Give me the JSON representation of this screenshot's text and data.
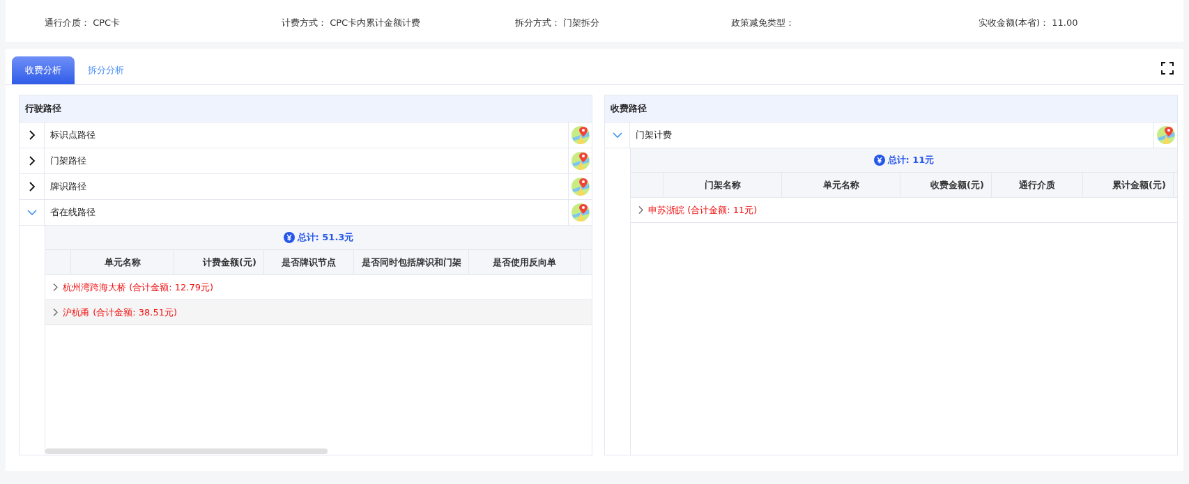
{
  "info": [
    {
      "label": "通行介质：",
      "value": "CPC卡"
    },
    {
      "label": "计费方式：",
      "value": "CPC卡内累计金额计费"
    },
    {
      "label": "拆分方式：",
      "value": "门架拆分"
    },
    {
      "label": "政策减免类型："
    },
    {
      "label": "实收金额(本省)：",
      "value": "11.00"
    }
  ],
  "tabs": [
    {
      "label": "收费分析",
      "selected": true
    },
    {
      "label": "拆分分析",
      "selected": false
    }
  ],
  "panels": [
    {
      "title": "行驶路径",
      "scrollable": true,
      "routes": [
        {
          "name": "标识点路径",
          "expanded": false
        },
        {
          "name": "门架路径",
          "expanded": false
        },
        {
          "name": "牌识路径",
          "expanded": false
        },
        {
          "name": "省在线路径",
          "expanded": true,
          "total": "总计: 51.3元",
          "columns": [
            {
              "label": "单元名称",
              "kind": "text"
            },
            {
              "label": "计费金额(元)",
              "kind": "amount"
            },
            {
              "label": "是否牌识节点",
              "kind": "text"
            },
            {
              "label": "是否同时包括牌识和门架",
              "kind": "text"
            },
            {
              "label": "是否使用反向单",
              "kind": "text"
            }
          ],
          "groups": [
            {
              "label": "杭州湾跨海大桥 (合计金额: 12.79元)",
              "hovered": false
            },
            {
              "label": "沪杭甬 (合计金额: 38.51元)",
              "hovered": true
            }
          ]
        }
      ]
    },
    {
      "title": "收费路径",
      "scrollable": false,
      "routes": [
        {
          "name": "门架计费",
          "expanded": true,
          "total": "总计: 11元",
          "columns": [
            {
              "label": "门架名称",
              "kind": "text"
            },
            {
              "label": "单元名称",
              "kind": "text"
            },
            {
              "label": "收费金额(元)",
              "kind": "amount"
            },
            {
              "label": "通行介质",
              "kind": "text"
            },
            {
              "label": "累计金额(元)",
              "kind": "amount"
            }
          ],
          "groups": [
            {
              "label": "申苏浙皖 (合计金额: 11元)",
              "hovered": false
            }
          ]
        }
      ]
    }
  ]
}
